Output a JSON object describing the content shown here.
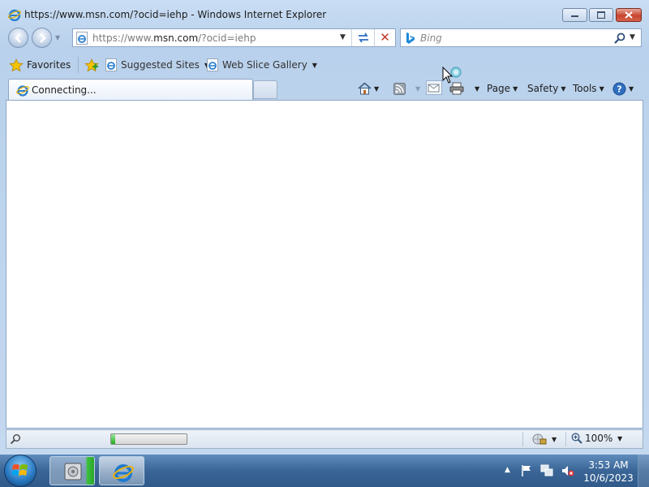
{
  "window": {
    "title": "https://www.msn.com/?ocid=iehp - Windows Internet Explorer",
    "controls": {
      "minimize_icon": "minimize-icon",
      "maximize_icon": "maximize-icon",
      "close_icon": "close-icon"
    }
  },
  "address_bar": {
    "url_prefix": "https://www.",
    "url_domain": "msn.com",
    "url_suffix": "/?ocid=iehp"
  },
  "search": {
    "placeholder": "Bing"
  },
  "favorites_bar": {
    "favorites_label": "Favorites",
    "links": [
      {
        "label": "Suggested Sites"
      },
      {
        "label": "Web Slice Gallery"
      }
    ]
  },
  "tab": {
    "label": "Connecting..."
  },
  "command_bar": {
    "page_label": "Page",
    "safety_label": "Safety",
    "tools_label": "Tools"
  },
  "status_bar": {
    "progress_fraction": 0.05,
    "zoom_label": "100%"
  },
  "taskbar": {
    "time": "3:53 AM",
    "date": "10/6/2023"
  },
  "colors": {
    "accent_blue": "#2b7cc4",
    "progress_green": "#1fb01f",
    "close_red": "#c8452f"
  }
}
